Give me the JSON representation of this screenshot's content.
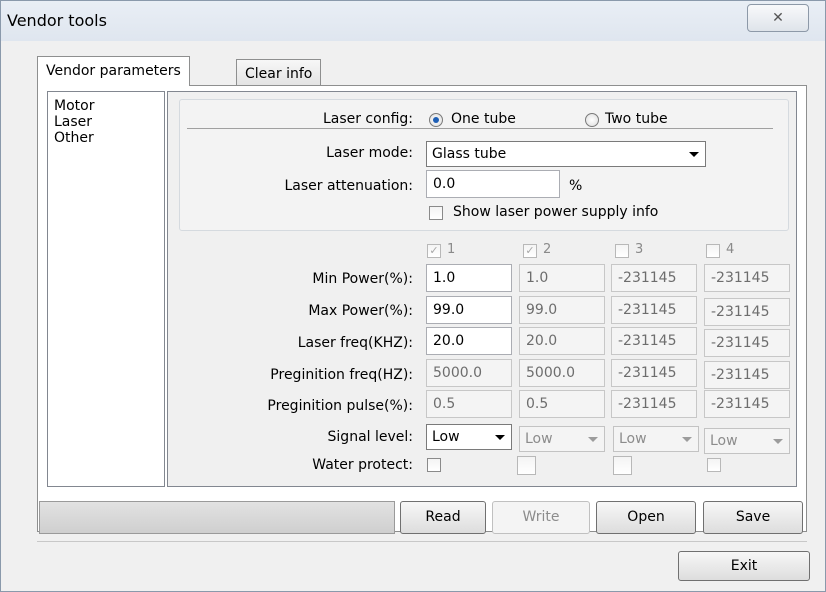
{
  "window": {
    "title": "Vendor tools",
    "close_glyph": "✕"
  },
  "tabs": [
    {
      "label": "Vendor parameters"
    },
    {
      "label": "Clear info"
    }
  ],
  "tree": {
    "items": [
      {
        "label": "Motor"
      },
      {
        "label": "Laser"
      },
      {
        "label": "Other"
      }
    ]
  },
  "laser": {
    "config_label": "Laser config:",
    "config_options": [
      {
        "label": "One tube",
        "selected": true
      },
      {
        "label": "Two tube",
        "selected": false
      }
    ],
    "mode_label": "Laser mode:",
    "mode_value": "Glass tube",
    "attenuation_label": "Laser attenuation:",
    "attenuation_value": "0.0",
    "attenuation_unit": "%",
    "show_supply_label": "Show laser power supply info",
    "show_supply_checked": false
  },
  "tubes": {
    "columns": [
      {
        "label": "1",
        "checked": true
      },
      {
        "label": "2",
        "checked": true
      },
      {
        "label": "3",
        "checked": false
      },
      {
        "label": "4",
        "checked": false
      }
    ],
    "rows": [
      {
        "label": "Min Power(%):",
        "values": [
          "1.0",
          "1.0",
          "-231145",
          "-231145"
        ]
      },
      {
        "label": "Max Power(%):",
        "values": [
          "99.0",
          "99.0",
          "-231145",
          "-231145"
        ]
      },
      {
        "label": "Laser freq(KHZ):",
        "values": [
          "20.0",
          "20.0",
          "-231145",
          "-231145"
        ]
      },
      {
        "label": "Preginition freq(HZ):",
        "values": [
          "5000.0",
          "5000.0",
          "-231145",
          "-231145"
        ]
      },
      {
        "label": "Preginition pulse(%):",
        "values": [
          "0.5",
          "0.5",
          "-231145",
          "-231145"
        ]
      }
    ],
    "signal_label": "Signal level:",
    "signal_values": [
      "Low",
      "Low",
      "Low",
      "Low"
    ],
    "water_label": "Water protect:"
  },
  "buttons": {
    "read": "Read",
    "write": "Write",
    "open": "Open",
    "save": "Save",
    "exit": "Exit"
  }
}
